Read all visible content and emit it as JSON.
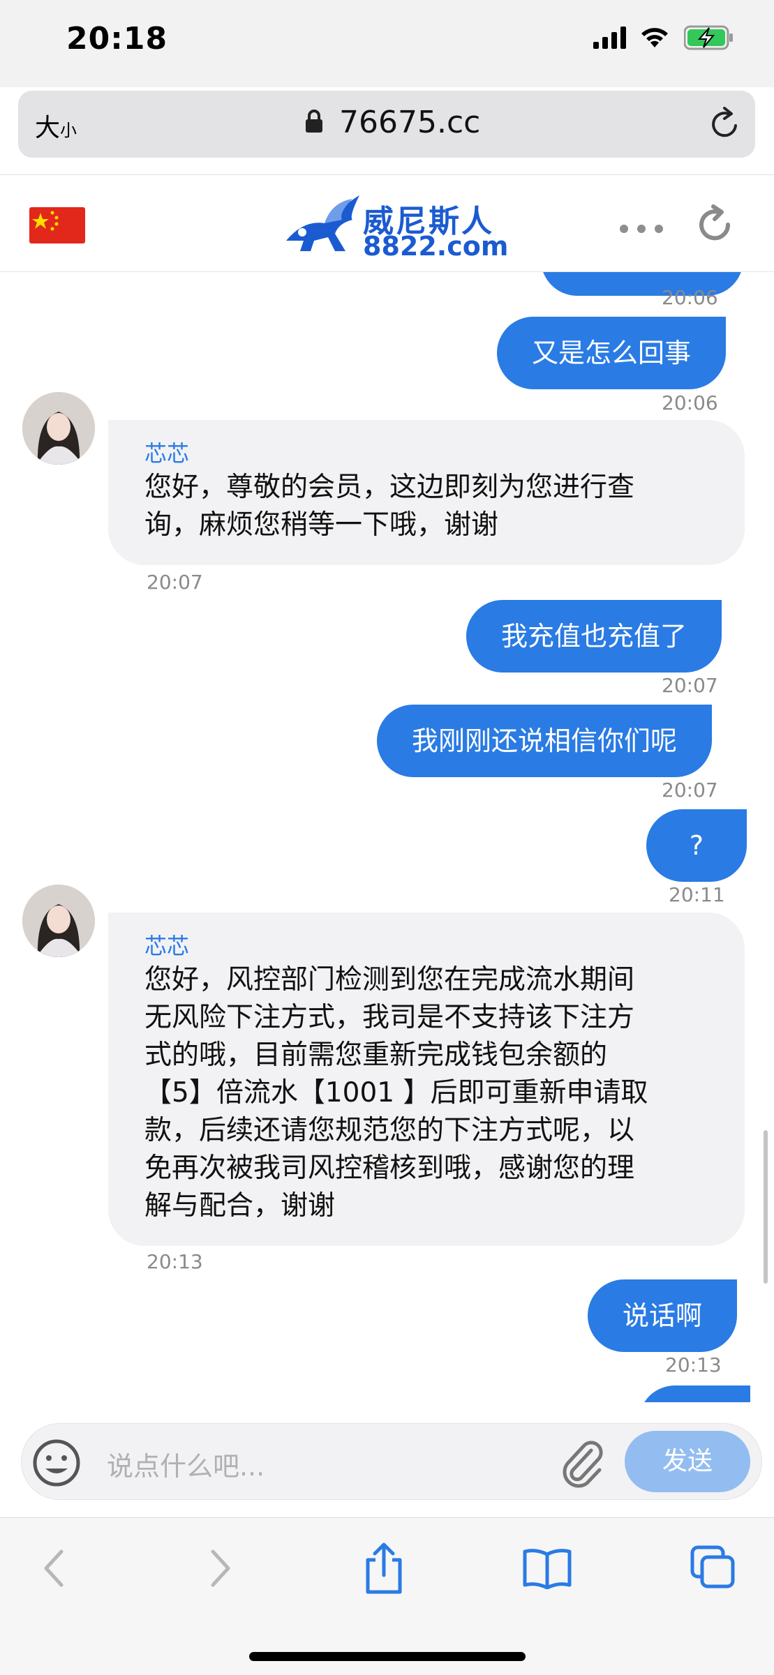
{
  "status": {
    "time": "20:18"
  },
  "browser": {
    "text_size_big": "大",
    "text_size_small": "小",
    "url": "76675.cc"
  },
  "site": {
    "logo_cn": "威尼斯人",
    "logo_en": "8822.com",
    "flag": "China flag"
  },
  "messages": [
    {
      "type": "out",
      "text": "",
      "time": "20:06"
    },
    {
      "type": "out",
      "text": "又是怎么回事",
      "time": "20:06"
    },
    {
      "type": "in",
      "name": "芯芯",
      "lines": [
        "您好，尊敬的会员，这边即刻为您进行查",
        "询，麻烦您稍等一下哦，谢谢"
      ],
      "time": "20:07"
    },
    {
      "type": "out",
      "text": "我充值也充值了",
      "time": "20:07"
    },
    {
      "type": "out",
      "text": "我刚刚还说相信你们呢",
      "time": "20:07"
    },
    {
      "type": "out",
      "text": "?",
      "time": "20:11"
    },
    {
      "type": "in",
      "name": "芯芯",
      "lines": [
        "您好，风控部门检测到您在完成流水期间",
        "无风险下注方式，我司是不支持该下注方",
        "式的哦，目前需您重新完成钱包余额的",
        "【5】倍流水【1001 】后即可重新申请取",
        "款，后续还请您规范您的下注方式呢，以",
        "免再次被我司风控稽核到哦，感谢您的理",
        "解与配合，谢谢"
      ],
      "time": "20:13"
    },
    {
      "type": "out",
      "text": "说话啊",
      "time": "20:13"
    }
  ],
  "input": {
    "placeholder": "说点什么吧...",
    "send_label": "发送"
  },
  "colors": {
    "bubble_out": "#2a7be4",
    "bubble_in": "#f2f2f4",
    "agent_name": "#2a7be4",
    "send_disabled": "#93bdf0"
  },
  "icons": [
    "signal-icon",
    "wifi-icon",
    "battery-charging-icon",
    "lock-icon",
    "reload-icon",
    "more-icon",
    "refresh-icon",
    "emoji-icon",
    "attachment-icon",
    "back-icon",
    "forward-icon",
    "share-icon",
    "bookmarks-icon",
    "tabs-icon"
  ]
}
